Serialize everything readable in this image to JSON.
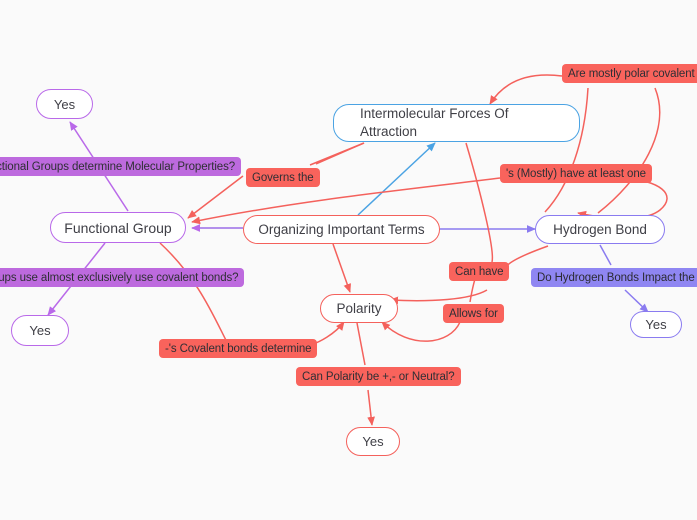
{
  "diagram": {
    "title": "Organizing Important Terms",
    "type": "mind-map",
    "background_color": "#fafafa",
    "colors": {
      "red": "#f4615c",
      "purple": "#b969e9",
      "indigo": "#8a7bf0",
      "blue": "#4ba3e3",
      "label_red": "#f9635c",
      "label_purple": "#bd6ade",
      "label_indigo": "#8f86f2",
      "node_fill": "#ffffff",
      "text": "#3f3f46"
    }
  },
  "nodes": [
    {
      "id": "yes-functional-properties",
      "label": "Yes",
      "color": "purple"
    },
    {
      "id": "functional-group",
      "label": "Functional Group",
      "color": "purple"
    },
    {
      "id": "yes-covalent-bonds",
      "label": "Yes",
      "color": "purple"
    },
    {
      "id": "intermolecular-forces",
      "label": "Intermolecular Forces Of\nAttraction",
      "color": "blue"
    },
    {
      "id": "organizing-important-terms",
      "label": "Organizing Important Terms",
      "color": "red"
    },
    {
      "id": "hydrogen-bond",
      "label": "Hydrogen Bond",
      "color": "indigo"
    },
    {
      "id": "polarity",
      "label": "Polarity",
      "color": "red"
    },
    {
      "id": "yes-ph-scale",
      "label": "Yes",
      "color": "indigo"
    },
    {
      "id": "yes-polarity-neutral",
      "label": "Yes",
      "color": "red"
    }
  ],
  "edge_labels": [
    {
      "id": "functional-groups-determine-molecular-properties",
      "text": "Do Functional Groups determine Molecular Properties?",
      "color": "purple",
      "truncated": true
    },
    {
      "id": "governs-the",
      "text": "Governs the",
      "color": "red"
    },
    {
      "id": "are-mostly-polar-covalent",
      "text": "Are mostly polar covalent unde",
      "color": "red",
      "truncated": true
    },
    {
      "id": "mostly-have-at-least-one",
      "text": "'s (Mostly) have at least one",
      "color": "red"
    },
    {
      "id": "groups-use-covalent-bonds",
      "text": "Do functional groups use almost exclusively use covalent bonds?",
      "color": "purple",
      "truncated": true
    },
    {
      "id": "can-have",
      "text": "Can have",
      "color": "red"
    },
    {
      "id": "do-hydrogen-bonds-impact-ph",
      "text": "Do Hydrogen Bonds Impact the pH sc",
      "color": "indigo",
      "truncated": true
    },
    {
      "id": "allows-for",
      "text": "Allows for",
      "color": "red"
    },
    {
      "id": "covalent-bonds-determine",
      "text": "-'s Covalent bonds determine",
      "color": "red"
    },
    {
      "id": "can-polarity-be-neutral",
      "text": "Can Polarity be +,- or Neutral?",
      "color": "red"
    }
  ]
}
